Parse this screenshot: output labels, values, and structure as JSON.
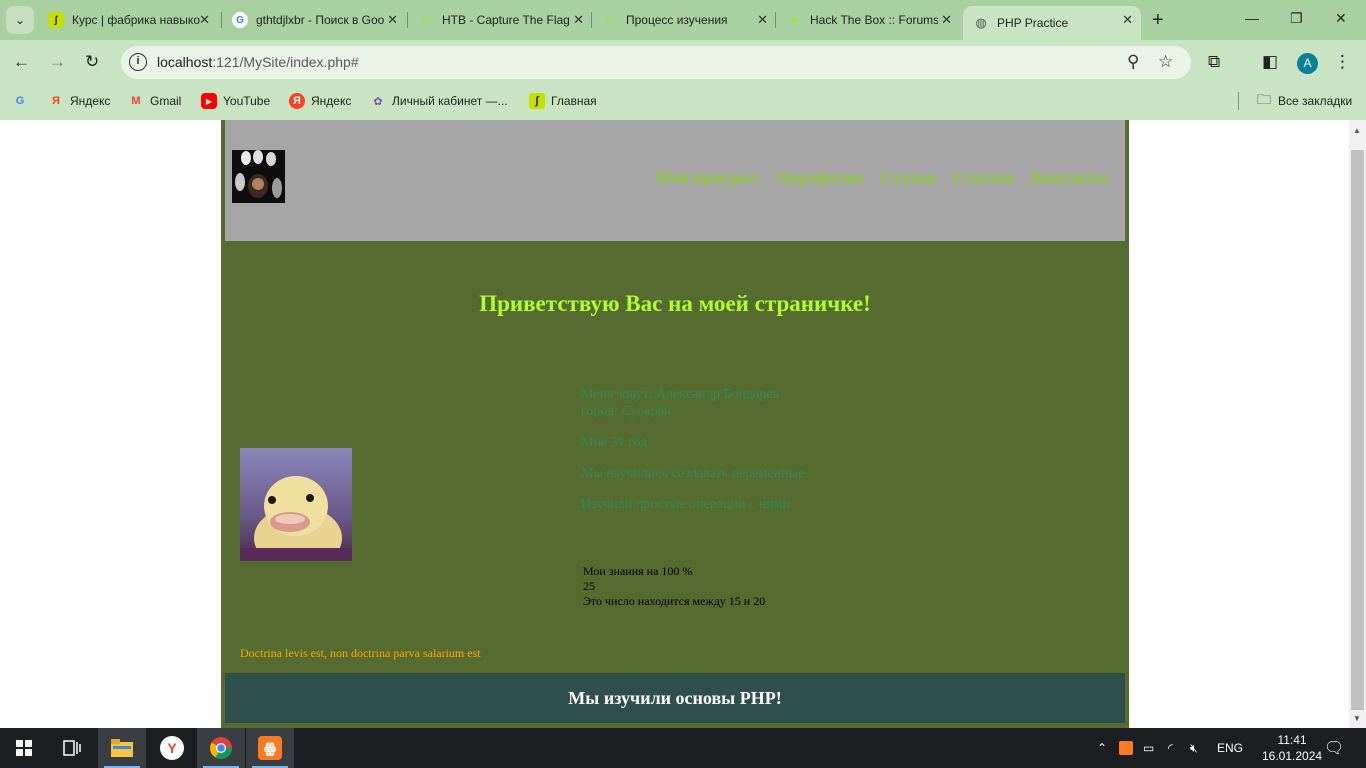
{
  "tabs": [
    {
      "title": "Курс | фабрика навыков",
      "favicon": "kurs-favicon"
    },
    {
      "title": "gthtdjlxbr - Поиск в Google",
      "favicon": "google-favicon"
    },
    {
      "title": "HTB - Capture The Flag",
      "favicon": "htb-favicon"
    },
    {
      "title": "Процесс изучения",
      "favicon": "htb-favicon"
    },
    {
      "title": "Hack The Box :: Forums",
      "favicon": "htb-forum-favicon"
    },
    {
      "title": "PHP Practice",
      "favicon": "globe-favicon",
      "active": true
    }
  ],
  "address": {
    "host": "localhost",
    "path": ":121/MySite/index.php#"
  },
  "bookmarks": [
    {
      "label": "Яндекс",
      "icon": "yandex-icon"
    },
    {
      "label": "Gmail",
      "icon": "gmail-icon"
    },
    {
      "label": "YouTube",
      "icon": "youtube-icon"
    },
    {
      "label": "Яндекс",
      "icon": "yandex-icon"
    },
    {
      "label": "Личный кабинет —...",
      "icon": "cabinet-icon"
    },
    {
      "label": "Главная",
      "icon": "kurs-icon"
    }
  ],
  "all_bookmarks": "Все закладки",
  "profile_letter": "A",
  "site": {
    "nav": [
      "Мой прогресс",
      "Портфолио",
      "Статьи",
      "Ссылки",
      "Контакты"
    ],
    "welcome": "Приветствую Вас на моей страничке!",
    "info": {
      "name": "Меня зовут: Александр Бондарев",
      "city": "город: Суоярви",
      "age": "Мне 31 год",
      "learned1": "Мы научились создавать переменные",
      "learned2": "Изучили простые операции с ними"
    },
    "calc": {
      "knowledge": "Мои знания на 100 %",
      "number": "25",
      "range": "Это число находится между 15 и 20"
    },
    "quote": "Doctrina levis est, non doctrina parva salarium est",
    "footer": "Мы изучили основы PHP!"
  },
  "taskbar": {
    "lang": "ENG",
    "time": "11:41",
    "date": "16.01.2024"
  },
  "colors": {
    "tabbar": "#a8d0a0",
    "toolbar": "#c8e4c2",
    "site_bg": "#566b2f",
    "header_bg": "#a6a6a6",
    "nav_link": "#8ec936",
    "welcome": "#adff2f",
    "info_text": "#2e8b57",
    "quote": "#ffa500",
    "footer_bg": "#2f4f4f"
  }
}
